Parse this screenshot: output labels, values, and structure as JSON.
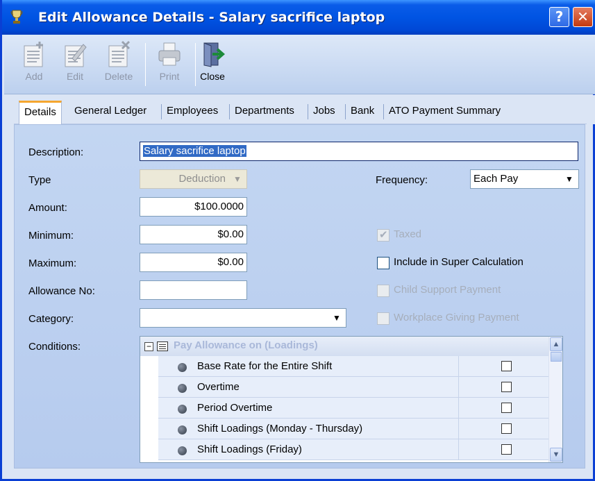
{
  "window": {
    "title": "Edit Allowance Details - Salary sacrifice laptop",
    "help_label": "?",
    "close_label": "✕"
  },
  "toolbar": {
    "add": "Add",
    "edit": "Edit",
    "delete": "Delete",
    "print": "Print",
    "close": "Close"
  },
  "tabs": [
    {
      "label": "Details",
      "active": true
    },
    {
      "label": "General Ledger"
    },
    {
      "label": "Employees"
    },
    {
      "label": "Departments"
    },
    {
      "label": "Jobs"
    },
    {
      "label": "Bank"
    },
    {
      "label": "ATO Payment Summary"
    }
  ],
  "form": {
    "description_label": "Description:",
    "description_value": "Salary sacrifice laptop",
    "type_label": "Type",
    "type_value": "Deduction",
    "frequency_label": "Frequency:",
    "frequency_value": "Each Pay",
    "amount_label": "Amount:",
    "amount_value": "$100.0000",
    "minimum_label": "Minimum:",
    "minimum_value": "$0.00",
    "maximum_label": "Maximum:",
    "maximum_value": "$0.00",
    "allowance_no_label": "Allowance No:",
    "allowance_no_value": "",
    "category_label": "Category:",
    "category_value": "",
    "conditions_label": "Conditions:"
  },
  "options": {
    "taxed": {
      "label": "Taxed",
      "checked": true,
      "enabled": false
    },
    "include_super": {
      "label": "Include in Super Calculation",
      "checked": false,
      "enabled": true
    },
    "child_support": {
      "label": "Child Support Payment",
      "checked": false,
      "enabled": false
    },
    "workplace_giving": {
      "label": "Workplace Giving Payment",
      "checked": false,
      "enabled": false
    }
  },
  "conditions": {
    "group_title": "Pay Allowance on (Loadings)",
    "expander": "−",
    "rows": [
      {
        "label": "Base Rate for the Entire Shift",
        "checked": false
      },
      {
        "label": "Overtime",
        "checked": false
      },
      {
        "label": "Period Overtime",
        "checked": false
      },
      {
        "label": "Shift Loadings (Monday - Thursday)",
        "checked": false
      },
      {
        "label": "Shift Loadings (Friday)",
        "checked": false
      }
    ]
  },
  "colors": {
    "titlebar": "#0054e3",
    "panel": "#c3d6f2",
    "active_tab_accent": "#f5a62f",
    "selection": "#316ac5"
  }
}
